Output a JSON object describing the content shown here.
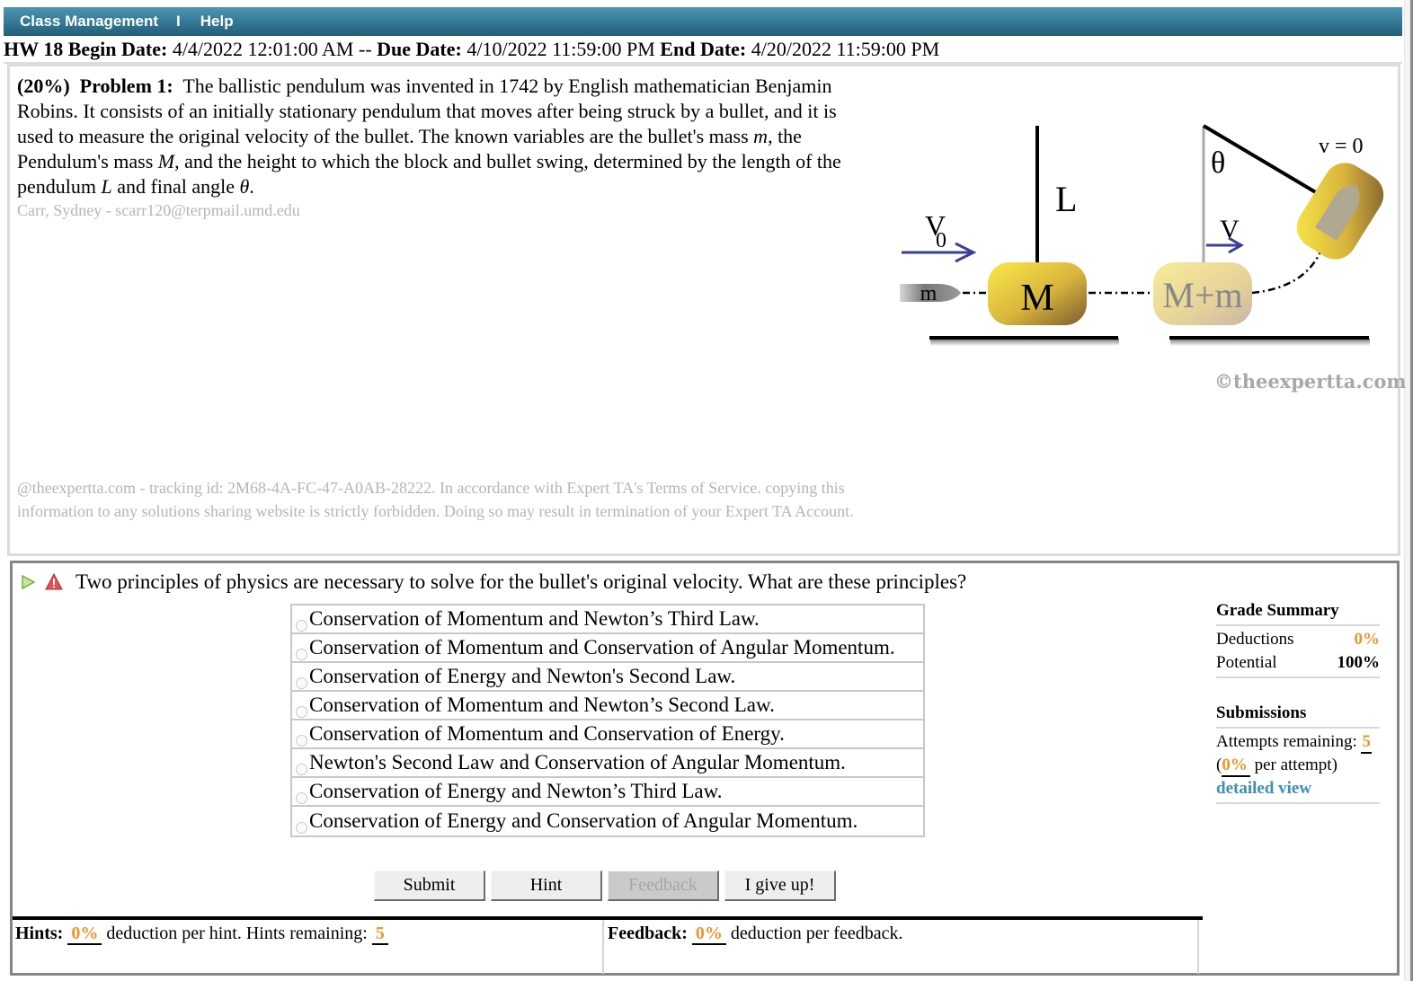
{
  "nav": {
    "items": [
      "Class Management",
      "Help"
    ],
    "separator": "I"
  },
  "header": {
    "hw": "HW 18",
    "begin_label": "Begin Date:",
    "begin": "4/4/2022 12:01:00 AM",
    "dash": "--",
    "due_label": "Due Date:",
    "due": "4/10/2022 11:59:00 PM",
    "end_label": "End Date:",
    "end": "4/20/2022 11:59:00 PM"
  },
  "problem": {
    "weight": "(20%)",
    "label": "Problem 1:",
    "text_1": "The ballistic pendulum was invented in 1742 by English mathematician Benjamin Robins. It consists of an initially stationary pendulum that moves after being struck by a bullet, and it is used to measure the original velocity of the bullet. The known variables are the bullet's mass ",
    "var_m": "m",
    "text_2": ", the Pendulum's mass ",
    "var_M": "M",
    "text_3": ", and the height to which the block and bullet swing, determined by the length of the pendulum ",
    "var_L": "L",
    "text_4": " and final angle ",
    "var_theta": "θ",
    "text_5": ".",
    "author": "Carr, Sydney - scarr120@terpmail.umd.edu",
    "tracking": "@theexpertta.com - tracking id: 2M68-4A-FC-47-A0AB-28222. In accordance with Expert TA's Terms of Service. copying this information to any solutions sharing website is strictly forbidden. Doing so may result in termination of your Expert TA Account."
  },
  "figure": {
    "labels": {
      "v0": "V",
      "v0_sub": "0",
      "L": "L",
      "M": "M",
      "m": "m",
      "Mm": "M+m",
      "v": "V",
      "theta": "θ",
      "v_zero": "v = 0"
    },
    "copyright": "©theexpertta.com"
  },
  "question": {
    "prompt": "Two principles of physics are necessary to solve for the bullet's original velocity. What are these principles?",
    "choices": [
      "Conservation of Momentum and Newton’s Third Law.",
      "Conservation of Momentum and Conservation of Angular Momentum.",
      "Conservation of Energy and Newton's Second Law.",
      "Conservation of Momentum and Newton’s Second Law.",
      "Conservation of Momentum and Conservation of Energy.",
      "Newton's Second Law and Conservation of Angular Momentum.",
      "Conservation of Energy and Newton’s Third Law.",
      "Conservation of Energy and Conservation of Angular Momentum."
    ],
    "buttons": {
      "submit": "Submit",
      "hint": "Hint",
      "feedback": "Feedback",
      "give_up": "I give up!"
    }
  },
  "hints": {
    "label": "Hints:",
    "deduction": "0%",
    "text": "deduction per hint. Hints remaining:",
    "remaining": "5"
  },
  "feedback": {
    "label": "Feedback:",
    "deduction": "0%",
    "text": "deduction per feedback."
  },
  "grade_summary": {
    "title": "Grade Summary",
    "deductions_label": "Deductions",
    "deductions": "0%",
    "potential_label": "Potential",
    "potential": "100%",
    "submissions_title": "Submissions",
    "attempts_label": "Attempts remaining:",
    "attempts": "5",
    "per_attempt_open": "(",
    "per_attempt": "0%",
    "per_attempt_text": "per attempt)",
    "detailed_view": "detailed view"
  },
  "colors": {
    "nav_bar": "#2d6f8c",
    "accent_orange": "#f0952c",
    "link_blue": "#3a90b6"
  }
}
